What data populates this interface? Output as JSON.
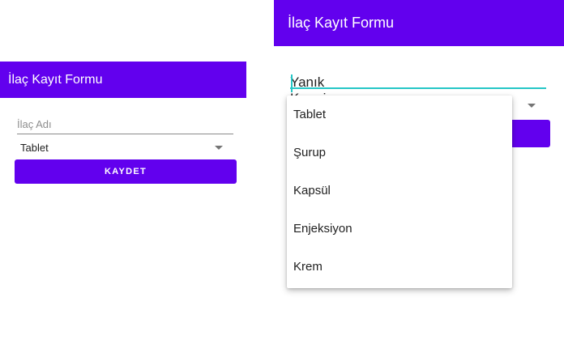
{
  "left_screen": {
    "appbar_title": "İlaç Kayıt Formu",
    "name_field": {
      "placeholder": "İlaç Adı",
      "value": ""
    },
    "form_spinner": {
      "selected": "Tablet"
    },
    "save_button_label": "KAYDET"
  },
  "right_screen": {
    "appbar_title": "İlaç Kayıt Formu",
    "name_field": {
      "value": "Yanık Kremi"
    },
    "dropdown_options": [
      "Tablet",
      "Şurup",
      "Kapsül",
      "Enjeksiyon",
      "Krem"
    ]
  },
  "colors": {
    "primary": "#6200ee",
    "accent": "#26c6c6",
    "on_primary": "#ffffff"
  },
  "icons": {
    "spinner_arrow": "dropdown-arrow-icon"
  }
}
